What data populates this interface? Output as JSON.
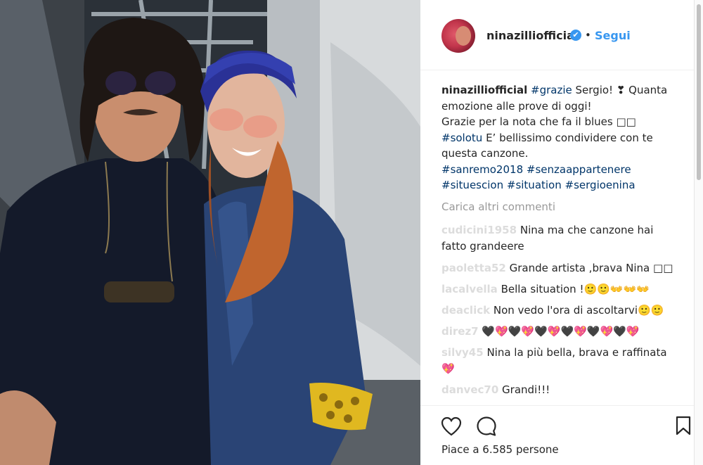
{
  "post": {
    "username": "ninazilliofficial",
    "verified_mark": "✔",
    "separator": "•",
    "follow_label": "Segui"
  },
  "caption": {
    "username": "ninazilliofficial",
    "tag_grazie": "#grazie",
    "text_1": " Sergio! ❣ Quanta emozione alle prove di oggi!",
    "text_2": "Grazie per la nota che fa il blues □□",
    "tag_solotu": "#solotu",
    "text_3": " E’ bellissimo condividere con te questa canzone.",
    "tag_sanremo": "#sanremo2018",
    "tag_senza": "#senzaappartenere",
    "tag_situescion": "#situescion",
    "tag_situation": "#situation",
    "tag_sergioenina": "#sergioenina"
  },
  "load_more_label": "Carica altri commenti",
  "comments": [
    {
      "user": "cudicini1958",
      "text": "Nina ma che canzone hai fatto grandeere"
    },
    {
      "user": "paoletta52",
      "text": "Grande artista ,brava Nina □□"
    },
    {
      "user": "lacalvella",
      "text": "Bella situation !🙂🙂👐👐👐"
    },
    {
      "user": "deaclick",
      "text": "Non vedo l'ora di ascoltarvi🙂🙂"
    },
    {
      "user": "direz7",
      "text": "🖤💖🖤💖🖤💖🖤💖🖤💖🖤💖"
    },
    {
      "user": "silvy45",
      "text": "Nina la più bella, brava e raffinata 💖"
    },
    {
      "user": "danvec70",
      "text": "Grandi!!!"
    }
  ],
  "likes_text": "Piace a 6.585 persone",
  "icons": {
    "like": "heart-icon",
    "comment": "comment-icon",
    "save": "bookmark-icon"
  },
  "colors": {
    "link": "#3897f0",
    "hashtag": "#003569",
    "muted": "#999999"
  }
}
